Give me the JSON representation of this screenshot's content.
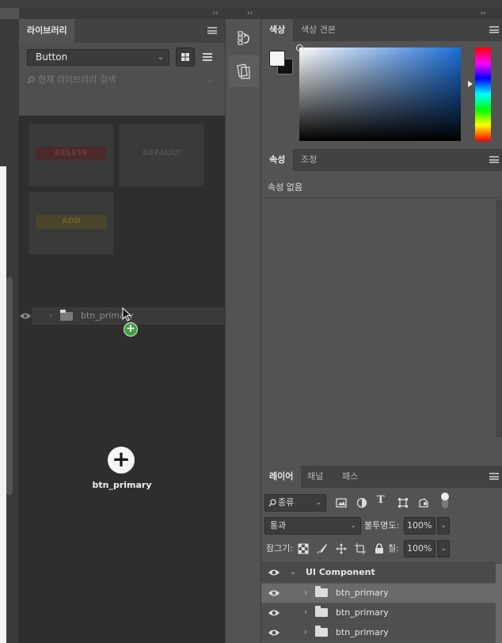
{
  "collapse_arrows": {
    "left": "››",
    "middle": "‹‹",
    "right": "››"
  },
  "libraries": {
    "tab_label": "라이브러리",
    "dropdown_value": "Button",
    "search_placeholder": "현재 라이브러리 검색",
    "thumbnails": [
      {
        "label": "DELETE",
        "color": "#5a2a2a"
      },
      {
        "label": "DEFAULT",
        "color": "#3d3d3d"
      },
      {
        "label": "ADD",
        "color": "#5a4f2a"
      }
    ],
    "dragged_layer_label": "btn_primary",
    "drop_label": "btn_primary",
    "drop_badge": "+"
  },
  "color_panel": {
    "tabs": [
      "색상",
      "색상 견본"
    ],
    "active_tab": "색상",
    "foreground_color": "#f5f5f5",
    "background_color": "#111111"
  },
  "properties_panel": {
    "tabs": [
      "속성",
      "조정"
    ],
    "active_tab": "속성",
    "empty_text": "속성 없음"
  },
  "layers_panel": {
    "tabs": [
      "레이어",
      "채널",
      "패스"
    ],
    "active_tab": "레이어",
    "filter_kind": "종류",
    "blend_mode": "통과",
    "opacity_label": "불투명도:",
    "opacity_value": "100%",
    "lock_label": "잠그기:",
    "fill_label": "칠:",
    "fill_value": "100%",
    "layers": [
      {
        "name": "UI Component",
        "type": "group",
        "expanded": true,
        "indent": 0,
        "selected": false
      },
      {
        "name": "btn_primary",
        "type": "group",
        "expanded": false,
        "indent": 1,
        "selected": true
      },
      {
        "name": "btn_primary",
        "type": "group",
        "expanded": false,
        "indent": 1,
        "selected": false
      },
      {
        "name": "btn_primary",
        "type": "group",
        "expanded": false,
        "indent": 1,
        "selected": false
      }
    ]
  },
  "colors": {
    "panel_bg": "#535353",
    "dark_bg": "#2e2e2e",
    "tabbar_bg": "#424242",
    "accent_green": "#3aa33a"
  }
}
